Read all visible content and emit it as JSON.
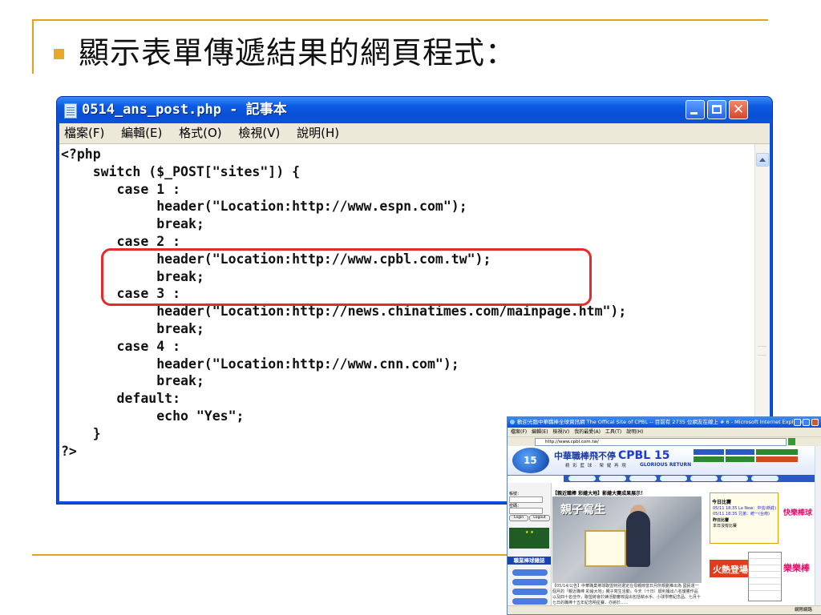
{
  "slide": {
    "title": "顯示表單傳遞結果的網頁程式："
  },
  "notepad": {
    "title": "0514_ans_post.php - 記事本",
    "menu": [
      "檔案(F)",
      "編輯(E)",
      "格式(O)",
      "檢視(V)",
      "說明(H)"
    ],
    "code_lines": [
      "<?php",
      "    switch ($_POST[\"sites\"]) {",
      "       case 1 :",
      "            header(\"Location:http://www.espn.com\");",
      "            break;",
      "       case 2 :",
      "            header(\"Location:http://www.cpbl.com.tw\");",
      "            break;",
      "       case 3 :",
      "            header(\"Location:http://news.chinatimes.com/mainpage.htm\");",
      "            break;",
      "       case 4 :",
      "            header(\"Location:http://www.cnn.com\");",
      "            break;",
      "       default:",
      "            echo \"Yes\";",
      "    }",
      "?>"
    ],
    "highlighted_lines": [
      6,
      7,
      8
    ],
    "highlight_color": "#e52a2a"
  },
  "browser": {
    "title": "歡迎光臨中華職棒全球資訊網 The Offical Site of CPBL -- 目前有 2735 位網友在線上 # 6 - Microsoft Internet Explorer",
    "menu": [
      "檔案(F)",
      "編輯(E)",
      "檢視(V)",
      "我的最愛(A)",
      "工具(T)",
      "說明(H)"
    ],
    "address": "http://www.cpbl.com.tw/",
    "status_right": "網際網路",
    "page": {
      "logo_number": "15",
      "banner_cn": "中華職棒飛不停",
      "banner_en": "CPBL 15",
      "banner_sub": "精 彩 藍 球 · 榮 耀 再 現",
      "banner_sub2": "GLORIOUS RETURN",
      "headline": "【親近職棒 彩繪大地】影繪大賽成果展示！",
      "photo_text": "親子寫生",
      "caption": "【05/14/公告】中華職業棒球聯盟特別選定在母親節當日月所規劃推出為 國民運一個月的「親近職棒 彩繪大地」親子寫生活動，今天（十日）順利獲出八名優勝作品以及四十名佳作，聯盟將會於練活動審核提出包括薪水手、小球學應紀念品、七月十七日的職棒十五年紀念明星賽、亦將於......",
      "today_title": "今日比賽",
      "today_lines": [
        "05/11 18:35 La New：中信(新莊)",
        "05/11 18:35 兄弟：統一(台南)",
        "昨日比賽",
        "本日沒有比賽"
      ],
      "fire_text": "火熱登場",
      "login_label": "帳號：",
      "login_label2": "密碼：",
      "login_btn": "Login",
      "logout_btn": "Logout",
      "mag_label": "職業棒球雜誌",
      "ad_text": "快樂棒球",
      "ad_text2": "樂樂棒"
    }
  }
}
